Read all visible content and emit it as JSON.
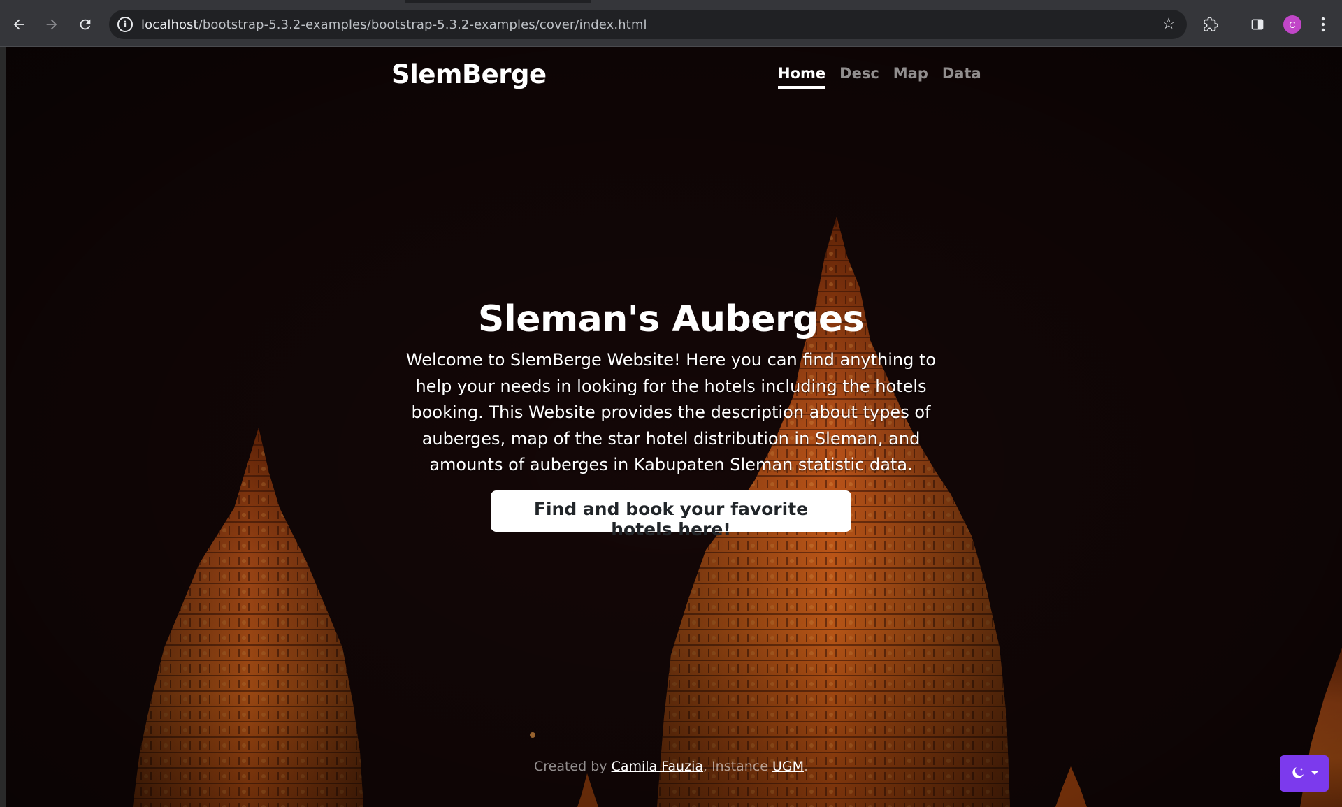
{
  "browser": {
    "url_host": "localhost",
    "url_path": "/bootstrap-5.3.2-examples/bootstrap-5.3.2-examples/cover/index.html",
    "avatar_letter": "C",
    "icons": {
      "back": "arrow-left-icon",
      "forward": "arrow-right-icon",
      "reload": "reload-icon",
      "site_info": "info-icon",
      "bookmark": "star-icon",
      "extensions": "puzzle-icon",
      "side_panel": "side-panel-icon",
      "menu": "kebab-menu-icon"
    }
  },
  "site": {
    "brand": "SlemBerge",
    "nav": [
      {
        "label": "Home",
        "active": true
      },
      {
        "label": "Desc",
        "active": false
      },
      {
        "label": "Map",
        "active": false
      },
      {
        "label": "Data",
        "active": false
      }
    ]
  },
  "hero": {
    "title": "Sleman's Auberges",
    "lead": "Welcome to SlemBerge Website! Here you can find anything to help your needs in looking for the hotels including the hotels booking. This Website provides the description about types of auberges, map of the star hotel distribution in Sleman, and amounts of auberges in Kabupaten Sleman statistic data.",
    "cta_label": "Find and book your favorite hotels here!"
  },
  "footer": {
    "prefix": "Created by ",
    "author": "Camila Fauzia",
    "middle": ", Instance ",
    "institution": "UGM",
    "suffix": "."
  },
  "theme_toggle": {
    "icons": [
      "moon-stars-icon",
      "caret-down-icon"
    ],
    "accent": "#7c3aed"
  },
  "colors": {
    "chrome_bg": "#35363a",
    "omnibox_bg": "#202124",
    "temple_orange": "#d9651a",
    "page_bg": "#140707"
  }
}
